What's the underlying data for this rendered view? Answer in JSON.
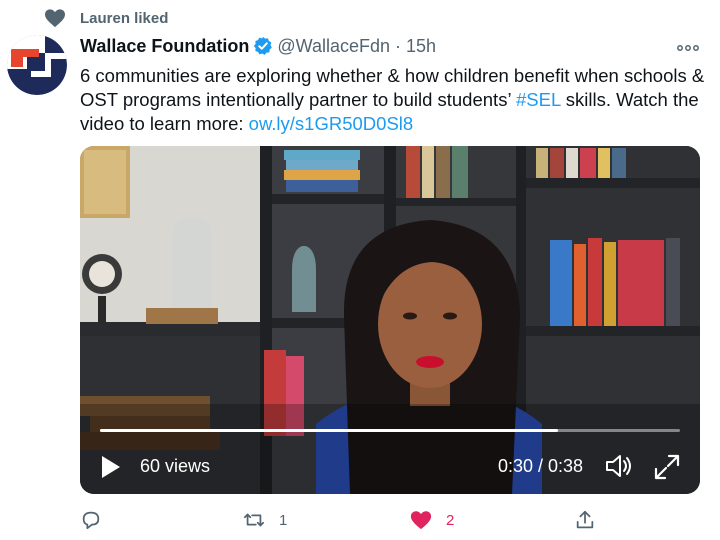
{
  "social_context": {
    "text": "Lauren liked",
    "icon": "heart-icon"
  },
  "author": {
    "name": "Wallace Foundation",
    "verified": true,
    "handle": "@WallaceFdn",
    "separator": "·",
    "time": "15h"
  },
  "tweet": {
    "text_before": "6 communities are exploring whether & how children benefit when schools & OST programs intentionally partner to build students’ ",
    "hashtag": "#SEL",
    "text_after": " skills. Watch the video to learn more: ",
    "link": "ow.ly/s1GR50D0Sl8"
  },
  "video": {
    "views": "60 views",
    "time": "0:30 / 0:38",
    "progress": 0.79
  },
  "actions": {
    "reply_count": "",
    "retweet_count": "1",
    "like_count": "2",
    "liked": true
  },
  "colors": {
    "accent": "#1d9bf0",
    "like_active": "#e0245e",
    "secondary_text": "#536471",
    "brand_red": "#e8452f",
    "brand_navy": "#1e2a5a"
  }
}
